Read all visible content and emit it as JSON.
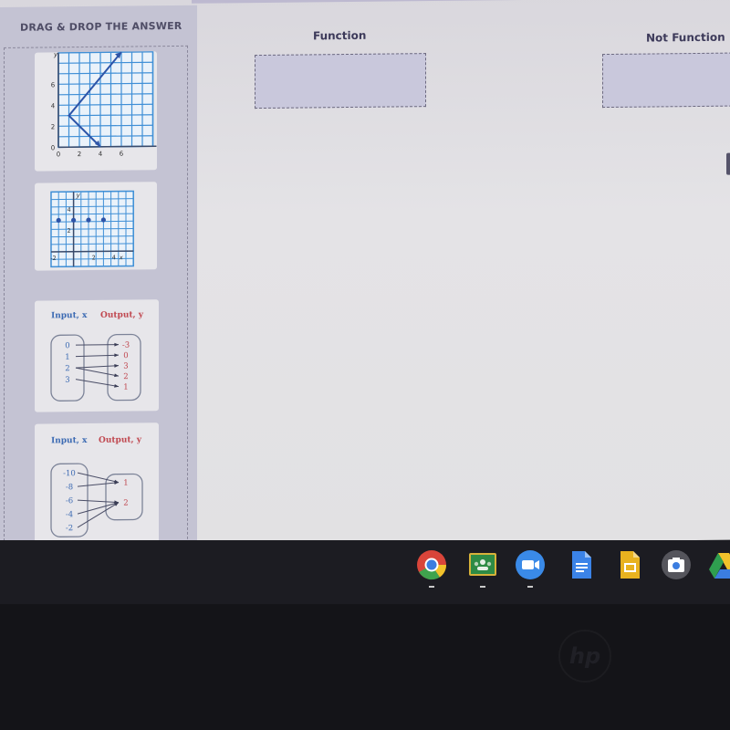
{
  "sidebar": {
    "title": "DRAG & DROP THE ANSWER",
    "cards": [
      {
        "type": "graph",
        "description": "Line graph: segment from (4,0) up-left to (1,3), then ray up-right to (6,9)",
        "x_ticks": [
          "0",
          "2",
          "4",
          "6"
        ],
        "x_label": "x",
        "y_ticks": [
          "0",
          "2",
          "4",
          "6"
        ],
        "y_label": "y",
        "points": [
          [
            4,
            0
          ],
          [
            1,
            3
          ],
          [
            6,
            9
          ]
        ]
      },
      {
        "type": "graph",
        "description": "Scatter points on a horizontal line y=3",
        "x_ticks": [
          "-2",
          "2",
          "4"
        ],
        "x_label": "x",
        "y_ticks": [
          "2",
          "4"
        ],
        "y_label": "y",
        "points": [
          [
            -2,
            3
          ],
          [
            0,
            3
          ],
          [
            2,
            3
          ],
          [
            4,
            3
          ]
        ]
      },
      {
        "type": "mapping",
        "input_label": "Input, x",
        "output_label": "Output, y",
        "inputs": [
          "0",
          "1",
          "2",
          "3"
        ],
        "outputs": [
          "-3",
          "0",
          "3",
          "2",
          "1"
        ],
        "arrows": [
          [
            0,
            0
          ],
          [
            1,
            1
          ],
          [
            2,
            2
          ],
          [
            2,
            3
          ],
          [
            3,
            4
          ]
        ]
      },
      {
        "type": "mapping",
        "input_label": "Input, x",
        "output_label": "Output, y",
        "inputs": [
          "-10",
          "-8",
          "-6",
          "-4",
          "-2"
        ],
        "outputs": [
          "1",
          "2"
        ],
        "arrows": [
          [
            0,
            0
          ],
          [
            1,
            0
          ],
          [
            2,
            1
          ],
          [
            3,
            1
          ],
          [
            4,
            1
          ]
        ]
      }
    ]
  },
  "columns": [
    {
      "title": "Function"
    },
    {
      "title": "Not Function"
    }
  ],
  "shelf": {
    "apps": [
      {
        "name": "chrome-icon",
        "active": true
      },
      {
        "name": "google-classroom-icon",
        "active": true
      },
      {
        "name": "zoom-icon",
        "active": true
      },
      {
        "name": "google-docs-icon",
        "active": false
      },
      {
        "name": "google-slides-icon",
        "active": false
      },
      {
        "name": "camera-icon",
        "active": false
      },
      {
        "name": "google-drive-icon",
        "active": false
      }
    ]
  },
  "colors": {
    "graph_line": "#2d54a8",
    "grid": "#3f8fd6",
    "input_text": "#3d6bb3",
    "output_text": "#c0474f",
    "drop_zone": "#c9c8dc"
  },
  "bezel_logo": "hp"
}
